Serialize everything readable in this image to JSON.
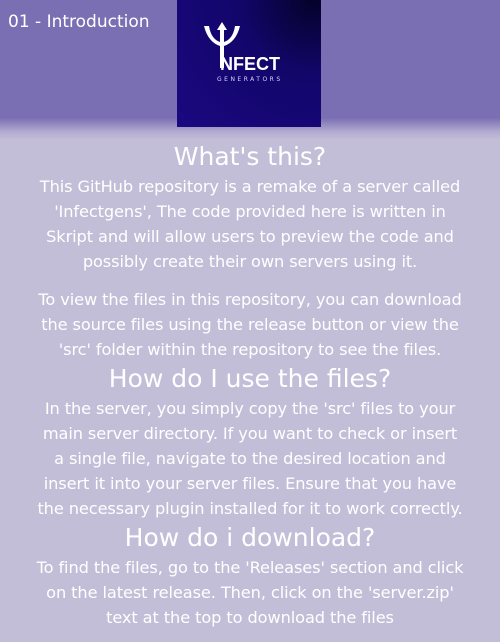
{
  "chapter_title": "01 - Introduction",
  "logo": {
    "brand": "NFECT",
    "sub": "GENERATORS",
    "text": "INFECT GENERATORS"
  },
  "colors": {
    "banner": "#7b6fb3",
    "background": "#c3bed8",
    "logo_bg": "#1a0880",
    "text": "#ffffff"
  },
  "sections": [
    {
      "heading": "What's this?",
      "paragraphs": [
        [
          "This GitHub repository is a remake of a server called",
          "'Infectgens', The code provided here is written in",
          "Skript and will allow users to preview the code and",
          "possibly create their own servers using it."
        ],
        [
          "To view the files in this repository, you can download",
          "the source files using the release button or view the",
          "'src' folder within the repository to see the files."
        ]
      ]
    },
    {
      "heading": "How do I use the files?",
      "paragraphs": [
        [
          "In the server, you simply copy the 'src' files to your",
          "main server directory. If you want to check or insert",
          "a single file, navigate to the desired location and",
          "insert it into your server files. Ensure that you have",
          "the necessary plugin installed for it to work correctly."
        ]
      ]
    },
    {
      "heading": "How do i download?",
      "paragraphs": [
        [
          "To find the files, go to the 'Releases' section and click",
          "on the latest release. Then, click on the 'server.zip'",
          "text at the top to download the files"
        ]
      ]
    }
  ]
}
